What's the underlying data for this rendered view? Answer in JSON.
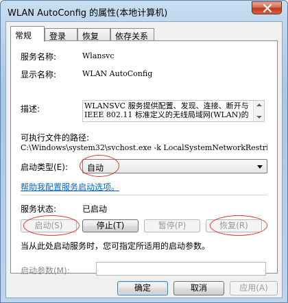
{
  "window": {
    "title": "WLAN AutoConfig 的属性(本地计算机)"
  },
  "tabs": [
    {
      "label": "常规",
      "active": true
    },
    {
      "label": "登录",
      "active": false
    },
    {
      "label": "恢复",
      "active": false
    },
    {
      "label": "依存关系",
      "active": false
    }
  ],
  "general": {
    "service_name_label": "服务名称:",
    "service_name_value": "Wlansvc",
    "display_name_label": "显示名称:",
    "display_name_value": "WLAN AutoConfig",
    "description_label": "描述:",
    "description_value": "WLANSVC 服务提供配置、发现、连接、断开与 IEEE 802.11 标准定义的无线局域网(WLAN)的",
    "exe_path_label": "可执行文件的路径:",
    "exe_path_value": "C:\\Windows\\system32\\svchost.exe -k LocalSystemNetworkRestricted",
    "startup_type_label": "启动类型(E):",
    "startup_type_value": "自动",
    "help_link": "帮助我配置服务启动选项。",
    "service_status_label": "服务状态:",
    "service_status_value": "已启动",
    "start_button": "启动(S)",
    "stop_button": "停止(T)",
    "pause_button": "暂停(P)",
    "resume_button": "恢复(R)",
    "start_params_hint": "当从此处启动服务时，您可指定所适用的启动参数。",
    "start_params_label": "启动参数(M):",
    "start_params_value": ""
  },
  "footer": {
    "ok_button": "确定",
    "cancel_button": "取消",
    "apply_button": "应用(A)"
  },
  "colors": {
    "annotation": "#e0392a",
    "link": "#0066cc"
  }
}
